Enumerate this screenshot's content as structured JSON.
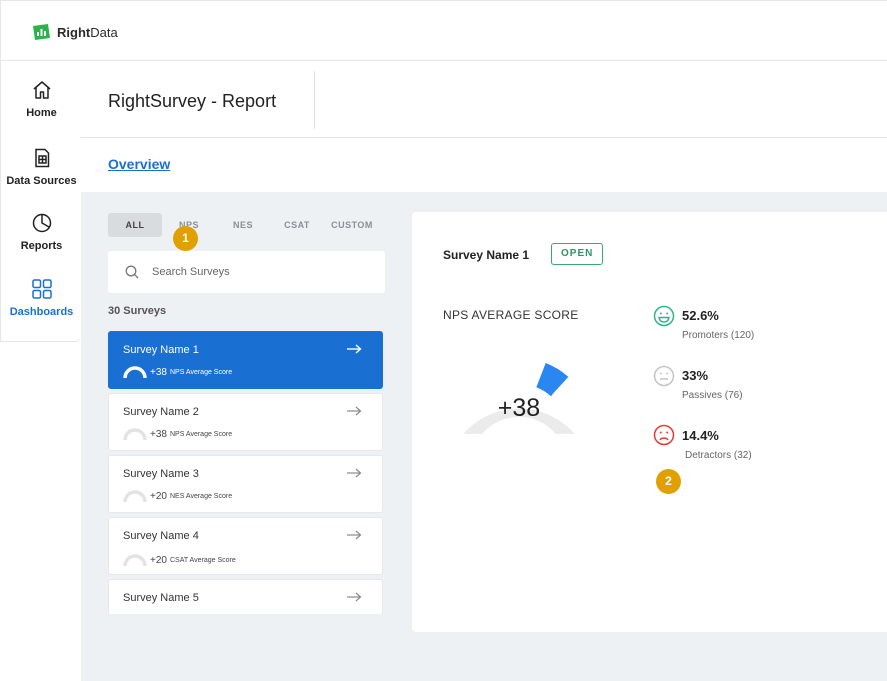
{
  "brand": {
    "name_bold": "Right",
    "name_rest": "Data",
    "accent": "#2fb24c"
  },
  "nav": {
    "items": [
      {
        "label": "Home",
        "icon": "home-icon"
      },
      {
        "label": "Data Sources",
        "icon": "data-sources-icon"
      },
      {
        "label": "Reports",
        "icon": "pie-chart-icon"
      },
      {
        "label": "Dashboards",
        "icon": "grid-icon",
        "active": true
      }
    ]
  },
  "header": {
    "title": "RightSurvey - Report"
  },
  "subheader": {
    "link": "Overview"
  },
  "filters": [
    "ALL",
    "NPS",
    "NES",
    "CSAT",
    "CUSTOM"
  ],
  "annotations": {
    "badge1": "1",
    "badge2": "2"
  },
  "search": {
    "placeholder": "Search Surveys"
  },
  "list": {
    "count": "30 Surveys",
    "surveys": [
      {
        "name": "Survey Name 1",
        "score": "+38",
        "metric": "NPS Average Score"
      },
      {
        "name": "Survey Name 2",
        "score": "+38",
        "metric": "NPS Average Score"
      },
      {
        "name": "Survey Name 3",
        "score": "+20",
        "metric": "NES Average Score"
      },
      {
        "name": "Survey Name 4",
        "score": "+20",
        "metric": "CSAT Average Score"
      },
      {
        "name": "Survey Name 5",
        "score": "",
        "metric": ""
      }
    ]
  },
  "detail": {
    "survey": "Survey Name 1",
    "status": "OPEN",
    "gauge_label": "NPS AVERAGE SCORE",
    "score_text": "+38",
    "score": 38,
    "score_min": -100,
    "score_max": 100,
    "stats": [
      {
        "value": "52.6%",
        "label": "Promoters (120)",
        "icon": "smile-icon",
        "color": "#2cb58a"
      },
      {
        "value": "33%",
        "label": "Passives (76)",
        "icon": "neutral-face-icon",
        "color": "#bdbdbd"
      },
      {
        "value": "14.4%",
        "label": "Detractors (32)",
        "icon": "frown-icon",
        "color": "#e53935"
      }
    ]
  },
  "colors": {
    "primary": "#1a6fd3",
    "badge": "#e0a100",
    "open": "#3aa874"
  }
}
